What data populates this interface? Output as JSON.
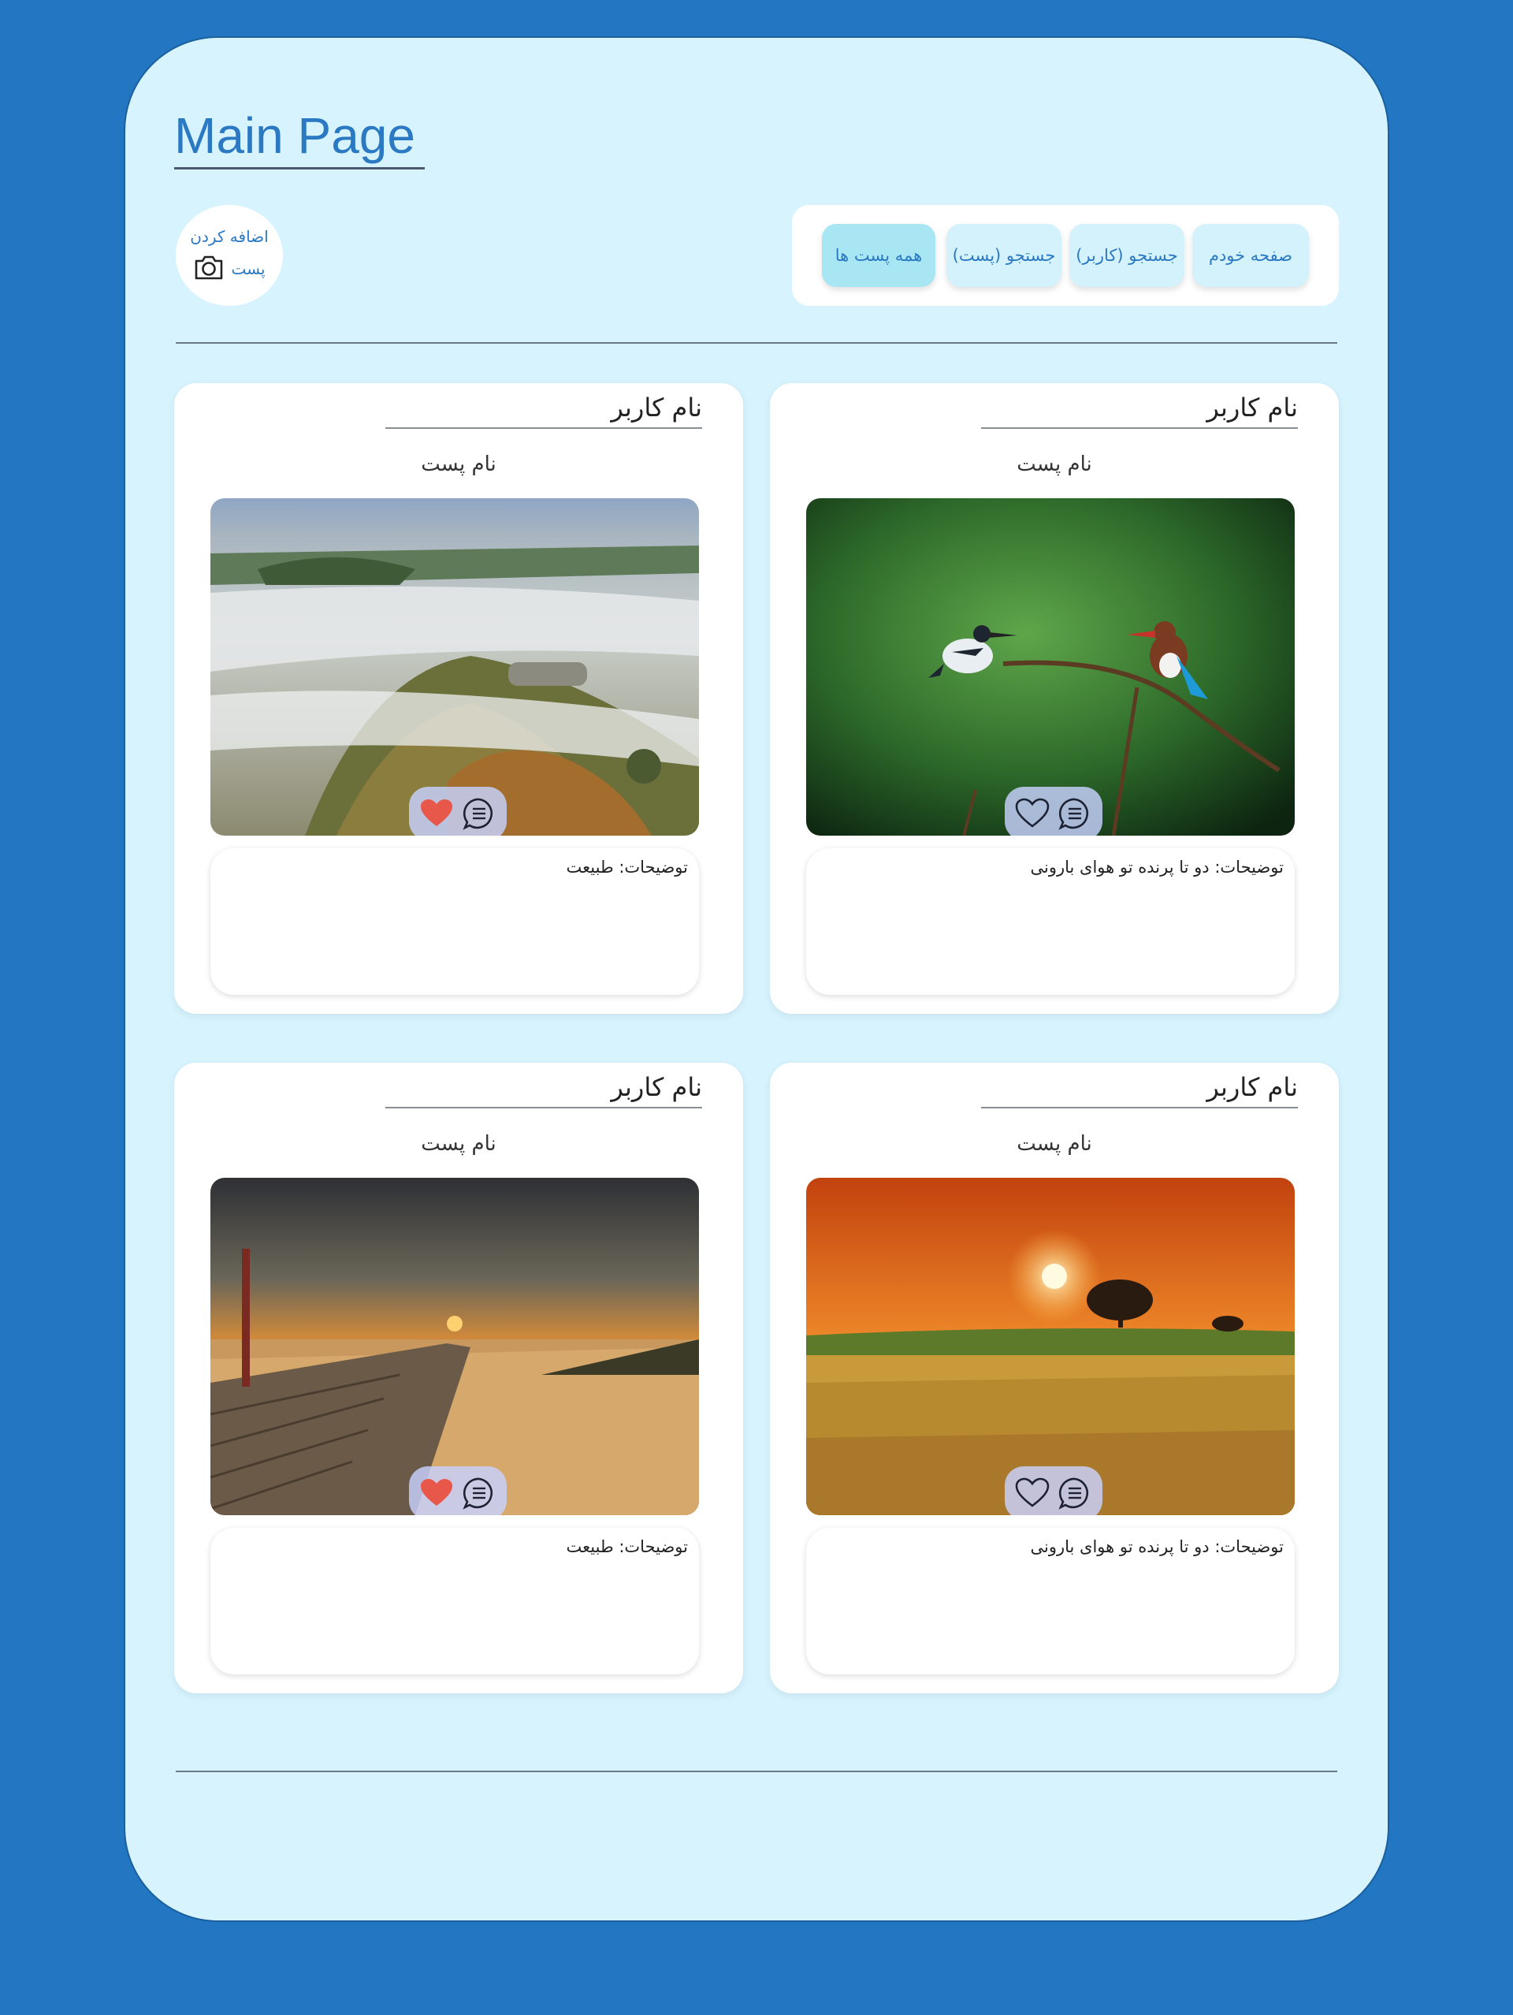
{
  "header": {
    "title": "Main Page",
    "add_post_line1": "اضافه کردن",
    "add_post_line2": "پست",
    "add_post_icon": "camera-icon"
  },
  "nav": {
    "items": [
      {
        "label": "صفحه خودم"
      },
      {
        "label": "جستجو (کاربر)"
      },
      {
        "label": "جستجو (پست)"
      },
      {
        "label": "همه پست ها",
        "active": true
      }
    ]
  },
  "posts": [
    {
      "username": "نام کاربر",
      "post_name": "نام پست",
      "description": "توضیحات: دو تا پرنده تو هوای بارونی",
      "liked": false,
      "image": "kingfishers-on-branch"
    },
    {
      "username": "نام کاربر",
      "post_name": "نام پست",
      "description": "توضیحات: طبیعت",
      "liked": true,
      "image": "misty-valley-aerial"
    },
    {
      "username": "نام کاربر",
      "post_name": "نام پست",
      "description": "توضیحات: دو تا پرنده تو هوای بارونی",
      "liked": false,
      "image": "sunset-wheat-field"
    },
    {
      "username": "نام کاربر",
      "post_name": "نام پست",
      "description": "توضیحات: طبیعت",
      "liked": true,
      "image": "beach-boardwalk-sunset"
    }
  ],
  "colors": {
    "background": "#2276c2",
    "panel": "#d7f4fe",
    "accent_text": "#2b79c2",
    "nav_button": "#d4f2fc",
    "nav_button_active": "#a9e6f4",
    "like_active": "#e8584a"
  }
}
